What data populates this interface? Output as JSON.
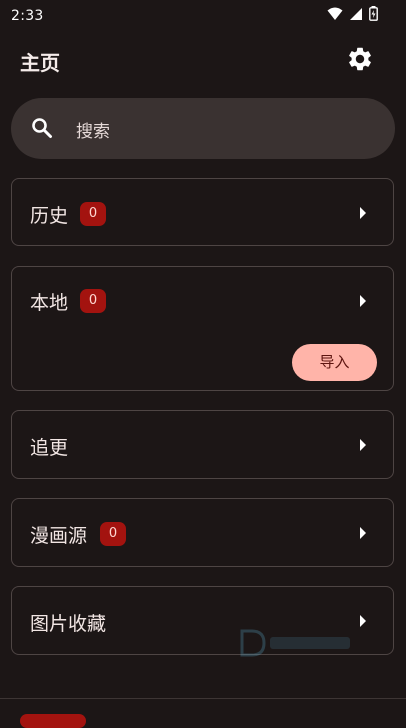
{
  "status_bar": {
    "time": "2:33",
    "icons": [
      "wifi-icon",
      "signal-icon",
      "battery-icon"
    ]
  },
  "app_bar": {
    "title": "主页",
    "settings_icon": "gear-icon"
  },
  "search": {
    "placeholder": "搜索",
    "icon": "search-icon"
  },
  "sections": {
    "history": {
      "label": "历史",
      "count": "0"
    },
    "local": {
      "label": "本地",
      "count": "0",
      "import_label": "导入"
    },
    "follow": {
      "label": "追更"
    },
    "sources": {
      "label": "漫画源",
      "count": "0"
    },
    "favorites": {
      "label": "图片收藏"
    }
  },
  "colors": {
    "background": "#1c1616",
    "badge": "#a3130f",
    "import_button": "#ffb4a9",
    "search_bar": "#3a3231",
    "card_border": "#4e4544"
  }
}
